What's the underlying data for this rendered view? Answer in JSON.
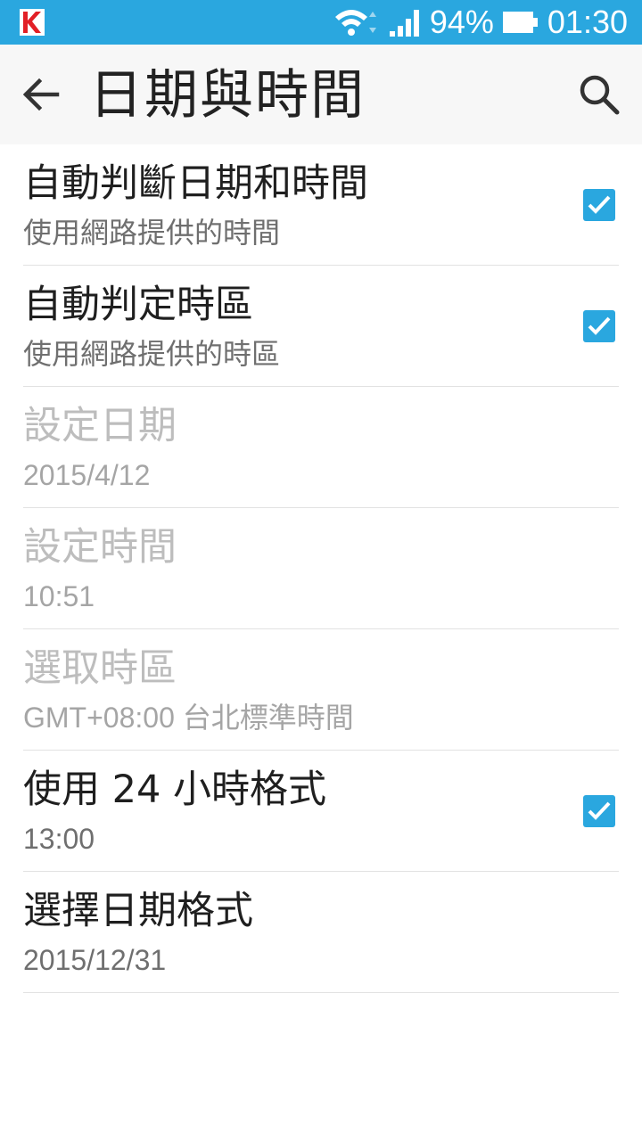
{
  "status_bar": {
    "battery_percent": "94%",
    "time": "01:30",
    "app_icon": "kaspersky-k-icon",
    "colors": {
      "background": "#2aa7df"
    }
  },
  "app_bar": {
    "title": "日期與時間",
    "back_icon": "back-arrow-icon",
    "search_icon": "search-icon"
  },
  "settings": [
    {
      "title": "自動判斷日期和時間",
      "subtitle": "使用網路提供的時間",
      "checked": true,
      "enabled": true
    },
    {
      "title": "自動判定時區",
      "subtitle": "使用網路提供的時區",
      "checked": true,
      "enabled": true
    },
    {
      "title": "設定日期",
      "subtitle": "2015/4/12",
      "enabled": false
    },
    {
      "title": "設定時間",
      "subtitle": "10:51",
      "enabled": false
    },
    {
      "title": "選取時區",
      "subtitle": "GMT+08:00 台北標準時間",
      "enabled": false
    },
    {
      "title": "使用 24 小時格式",
      "subtitle": "13:00",
      "checked": true,
      "enabled": true
    },
    {
      "title": "選擇日期格式",
      "subtitle": "2015/12/31",
      "enabled": true
    }
  ],
  "colors": {
    "accent": "#2aa7df"
  }
}
